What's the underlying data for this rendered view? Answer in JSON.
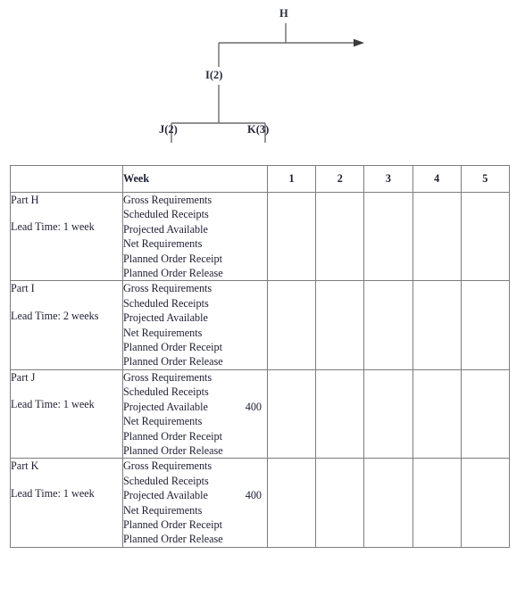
{
  "bom_tree": {
    "nodes": [
      {
        "id": "h",
        "label": "H"
      },
      {
        "id": "i",
        "label": "I(2)"
      },
      {
        "id": "j",
        "label": "J(2)"
      },
      {
        "id": "k",
        "label": "K(3)"
      }
    ],
    "line_color": "#6b6b6b"
  },
  "table": {
    "header": {
      "part_col": "",
      "week_col": "Week",
      "weeks": [
        "1",
        "2",
        "3",
        "4",
        "5"
      ]
    },
    "row_labels": [
      "Gross Requirements",
      "Scheduled Receipts",
      "Projected Available",
      "Net Requirements",
      "Planned Order Receipt",
      "Planned Order Release"
    ],
    "blocks": [
      {
        "part": "Part H",
        "lead_time": "Lead Time: 1 week",
        "values": [
          "",
          "",
          "",
          "",
          "",
          ""
        ],
        "weeks": [
          [
            "",
            "",
            "",
            "",
            "",
            ""
          ],
          [
            "",
            "",
            "",
            "",
            "",
            ""
          ],
          [
            "",
            "",
            "",
            "",
            "",
            ""
          ],
          [
            "",
            "",
            "",
            "",
            "",
            ""
          ],
          [
            "",
            "",
            "",
            "",
            "",
            ""
          ]
        ]
      },
      {
        "part": "Part I",
        "lead_time": "Lead Time: 2 weeks",
        "values": [
          "",
          "",
          "",
          "",
          "",
          ""
        ],
        "weeks": [
          [
            "",
            "",
            "",
            "",
            "",
            ""
          ],
          [
            "",
            "",
            "",
            "",
            "",
            ""
          ],
          [
            "",
            "",
            "",
            "",
            "",
            ""
          ],
          [
            "",
            "",
            "",
            "",
            "",
            ""
          ],
          [
            "",
            "",
            "",
            "",
            "",
            ""
          ]
        ]
      },
      {
        "part": "Part J",
        "lead_time": "Lead Time: 1 week",
        "values": [
          "",
          "",
          "400",
          "",
          "",
          ""
        ],
        "weeks": [
          [
            "",
            "",
            "",
            "",
            "",
            ""
          ],
          [
            "",
            "",
            "",
            "",
            "",
            ""
          ],
          [
            "",
            "",
            "",
            "",
            "",
            ""
          ],
          [
            "",
            "",
            "",
            "",
            "",
            ""
          ],
          [
            "",
            "",
            "",
            "",
            "",
            ""
          ]
        ]
      },
      {
        "part": "Part K",
        "lead_time": "Lead Time: 1 week",
        "values": [
          "",
          "",
          "400",
          "",
          "",
          ""
        ],
        "weeks": [
          [
            "",
            "",
            "",
            "",
            "",
            ""
          ],
          [
            "",
            "",
            "",
            "",
            "",
            ""
          ],
          [
            "",
            "",
            "",
            "",
            "",
            ""
          ],
          [
            "",
            "",
            "",
            "",
            "",
            ""
          ],
          [
            "",
            "",
            "",
            "",
            "",
            ""
          ]
        ]
      }
    ]
  }
}
